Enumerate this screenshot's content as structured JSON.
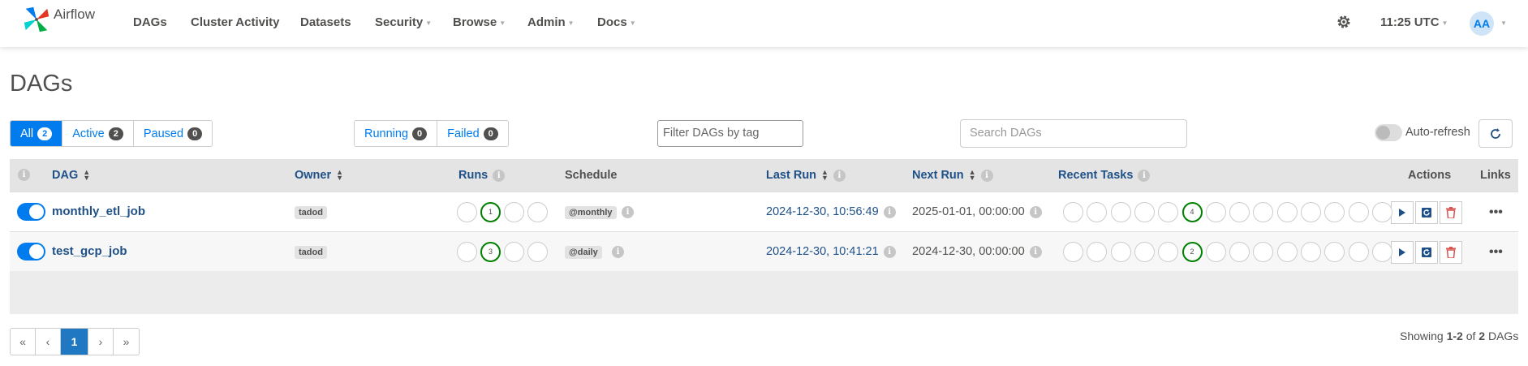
{
  "nav": {
    "brand": "Airflow",
    "items": [
      {
        "label": "DAGs",
        "dropdown": false
      },
      {
        "label": "Cluster Activity",
        "dropdown": false
      },
      {
        "label": "Datasets",
        "dropdown": false
      },
      {
        "label": "Security",
        "dropdown": true
      },
      {
        "label": "Browse",
        "dropdown": true
      },
      {
        "label": "Admin",
        "dropdown": true
      },
      {
        "label": "Docs",
        "dropdown": true
      }
    ],
    "time": "11:25 UTC",
    "avatar": "AA"
  },
  "page_title": "DAGs",
  "status_filters": [
    {
      "label": "All",
      "count": "2",
      "active": true
    },
    {
      "label": "Active",
      "count": "2",
      "active": false
    },
    {
      "label": "Paused",
      "count": "0",
      "active": false
    }
  ],
  "run_filters": [
    {
      "label": "Running",
      "count": "0"
    },
    {
      "label": "Failed",
      "count": "0"
    }
  ],
  "tag_filter_placeholder": "Filter DAGs by tag",
  "search_placeholder": "Search DAGs",
  "auto_refresh_label": "Auto-refresh",
  "table": {
    "headers": {
      "info": "i",
      "dag": "DAG",
      "owner": "Owner",
      "runs": "Runs",
      "schedule": "Schedule",
      "last_run": "Last Run",
      "next_run": "Next Run",
      "recent_tasks": "Recent Tasks",
      "actions": "Actions",
      "links": "Links"
    },
    "rows": [
      {
        "dag_id": "monthly_etl_job",
        "owner": "tadod",
        "runs_success": "1",
        "schedule": "@monthly",
        "last_run": "2024-12-30, 10:56:49",
        "next_run": "2025-01-01, 00:00:00",
        "recent_success": "4"
      },
      {
        "dag_id": "test_gcp_job",
        "owner": "tadod",
        "runs_success": "3",
        "schedule": "@daily",
        "last_run": "2024-12-30, 10:41:21",
        "next_run": "2024-12-30, 00:00:00",
        "recent_success": "2"
      }
    ]
  },
  "pagination": {
    "first": "«",
    "prev": "‹",
    "current": "1",
    "next": "›",
    "last": "»"
  },
  "showing": {
    "prefix": "Showing ",
    "range": "1-2",
    "middle": " of ",
    "total": "2",
    "suffix": " DAGs"
  },
  "colors": {
    "primary": "#017cee",
    "link": "#1f5188",
    "success": "#008000",
    "danger": "#d9534f"
  }
}
